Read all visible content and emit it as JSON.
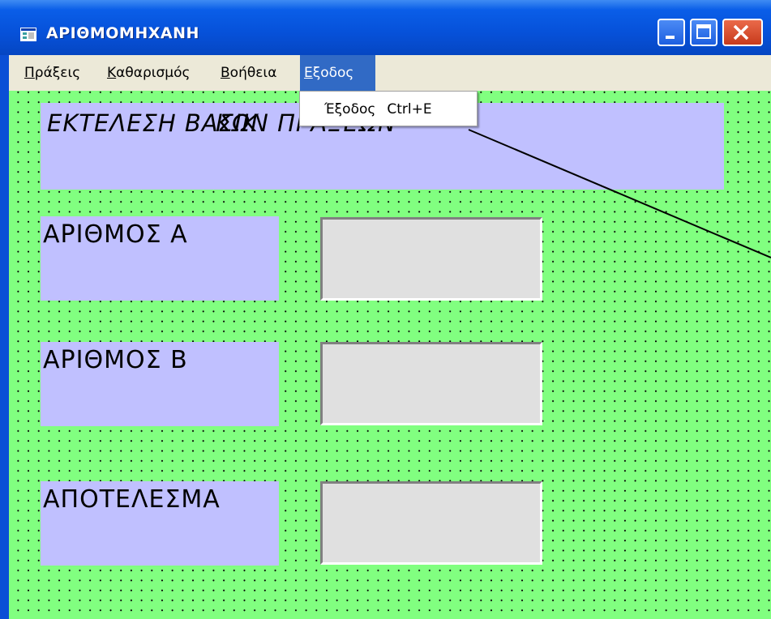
{
  "window": {
    "title": "ΑΡΙΘΜΟΜΗΧΑΝΗ"
  },
  "menubar": {
    "items": [
      {
        "label": "Πράξεις",
        "accel": "Π",
        "rest": "ράξεις"
      },
      {
        "label": "Καθαρισμός",
        "accel": "Κ",
        "rest": "αθαρισμός"
      },
      {
        "label": "Βοήθεια",
        "accel": "Β",
        "rest": "οήθεια"
      },
      {
        "label": "Εξοδος",
        "accel": "Ε",
        "rest": "ξοδος"
      }
    ]
  },
  "dropdown": {
    "item_label": "Έξοδος",
    "shortcut": "Ctrl+E"
  },
  "form": {
    "heading": "ΕΚΤΕΛΕΣΗ ΒΑΣΙΚ",
    "heading_tail": "ΚΩΝ ΠΡΑΞΕΩΝ",
    "label_a": "ΑΡΙΘΜΟΣ Α",
    "label_b": "ΑΡΙΘΜΟΣ Β",
    "label_result": "ΑΠΟΤΕΛΕΣΜΑ",
    "input_a": "",
    "input_b": "",
    "output_result": ""
  },
  "colors": {
    "form_background": "#81ff80",
    "label_background": "#c0c0ff",
    "textbox_background": "#e0e0e0",
    "menu_highlight": "#316ac5",
    "titlebar": "#0651d9"
  },
  "icons": [
    "app-icon",
    "minimize-icon",
    "maximize-icon",
    "close-icon"
  ]
}
